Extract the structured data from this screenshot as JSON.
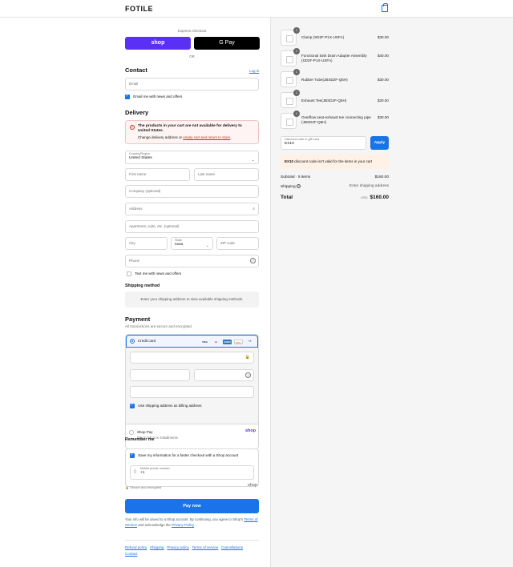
{
  "header": {
    "logo": "FOTILE",
    "cart_icon": "shopping-bag-icon"
  },
  "express": {
    "label": "Express checkout",
    "shop_pay": "shop",
    "google_pay": "G Pay",
    "or": "OR"
  },
  "contact": {
    "heading": "Contact",
    "login": "Log in",
    "email_placeholder": "Email",
    "news_label": "Email me with news and offers",
    "news_checked": true
  },
  "delivery": {
    "heading": "Delivery",
    "alert_title": "The products in your cart are not available for delivery to United States.",
    "alert_text_1": "Change delivery address or ",
    "alert_link": "empty cart and return to store",
    "alert_text_2": ".",
    "country_label": "Country/Region",
    "country_value": "United States",
    "first_name": "First name",
    "last_name": "Last name",
    "company": "Company (optional)",
    "address": "Address",
    "apartment": "Apartment, suite, etc. (optional)",
    "city": "City",
    "state_label": "State",
    "state_value": "Iowa",
    "zip": "ZIP code",
    "phone": "Phone",
    "text_me": "Text me with news and offers"
  },
  "shipping": {
    "heading": "Shipping method",
    "placeholder": "Enter your shipping address to view available shipping methods."
  },
  "payment": {
    "heading": "Payment",
    "subtitle": "All transactions are secure and encrypted.",
    "credit_card": "Credit card",
    "card_logos": [
      "VISA",
      "MC",
      "AMEX",
      "DISC"
    ],
    "more_cards": "+4",
    "billing_label": "Use shipping address as billing address",
    "shop_pay_title": "Shop Pay",
    "shop_pay_sub": "Pay in full or in installments",
    "shop_pay_logo": "shop"
  },
  "remember": {
    "heading": "Remember me",
    "save_label": "Save my information for a faster checkout with a Shop account",
    "phone_label": "Mobile phone number",
    "phone_value": "+1",
    "secure": "Secure and encrypted",
    "shop_logo": "shop"
  },
  "paynow": {
    "label": "Pay now",
    "disclaimer_1": "Your info will be saved to a Shop account. By continuing, you agree to Shop's ",
    "terms": "Terms of Service",
    "disclaimer_2": " and acknowledge the ",
    "privacy": "Privacy Policy",
    "disclaimer_3": "."
  },
  "footer": {
    "links": [
      "Refund policy",
      "Shipping",
      "Privacy policy",
      "Terms of service",
      "Cancellations"
    ],
    "contact": "Contact"
  },
  "summary": {
    "items": [
      {
        "qty": "1",
        "name": "Clamp (SD2F-P1X-USFA)",
        "price": "$30.00"
      },
      {
        "qty": "1",
        "name": "Functional Sink Drain Adapter Assembly (SD2F-P1X-USFA)",
        "price": "$40.00"
      },
      {
        "qty": "1",
        "name": "Rubber Tube(JBSD2F-Q5H)",
        "price": "$30.00"
      },
      {
        "qty": "1",
        "name": "Exhaust Tee(JBSD2F-Q5H)",
        "price": "$30.00"
      },
      {
        "qty": "1",
        "name": "Overflow seat-exhaust tee connecting pipe (JBSD2F-Q5H)",
        "price": "$30.00"
      }
    ],
    "discount_label": "Discount code or gift card",
    "discount_value": "EX10",
    "apply": "Apply",
    "warn_code": "EX10",
    "warn_text": " discount code isn't valid for the items in your cart",
    "subtotal_label": "Subtotal · 5 items",
    "subtotal_value": "$160.00",
    "shipping_label": "Shipping",
    "shipping_value": "Enter shipping address",
    "total_label": "Total",
    "currency": "USD",
    "total_value": "$160.00"
  }
}
